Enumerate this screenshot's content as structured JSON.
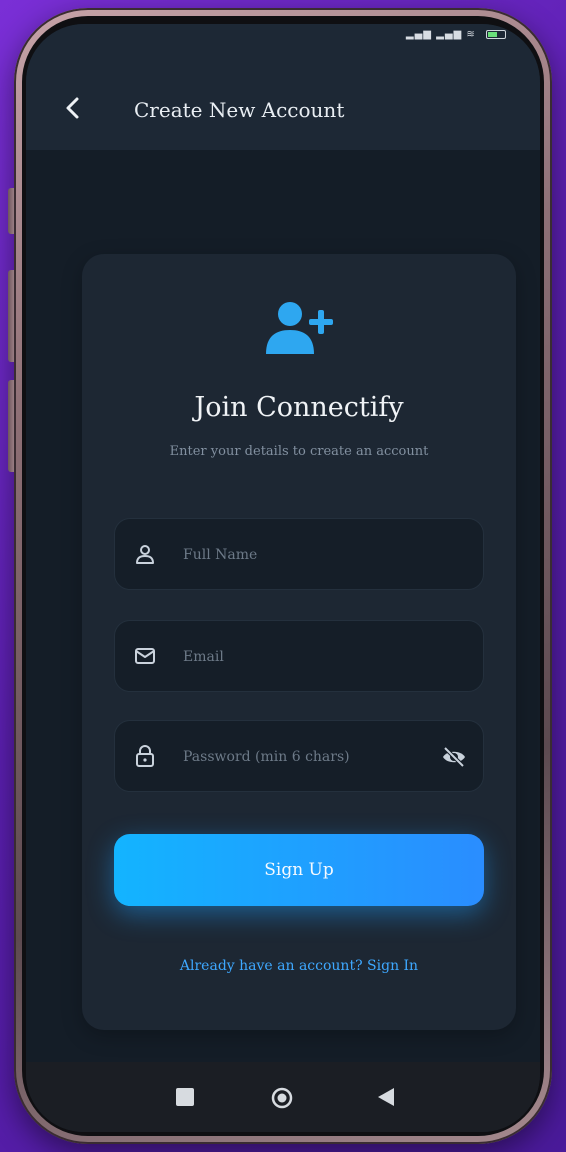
{
  "app_bar": {
    "title": "Create New Account",
    "back_icon": "chevron-left-icon"
  },
  "card": {
    "icon": "add-user-icon",
    "title": "Join Connectify",
    "subtitle": "Enter your details to create an account"
  },
  "form": {
    "full_name": {
      "placeholder": "Full Name",
      "value": "",
      "icon": "user-icon"
    },
    "email": {
      "placeholder": "Email",
      "value": "",
      "icon": "mail-icon"
    },
    "password": {
      "placeholder": "Password (min 6 chars)",
      "value": "",
      "icon": "lock-icon",
      "toggle_icon": "eye-off-icon"
    }
  },
  "signup_button": {
    "label": "Sign Up"
  },
  "signin_link": {
    "label": "Already have an account? Sign In"
  },
  "nav_bar": {
    "items": [
      "recent-apps-icon",
      "home-icon",
      "back-triangle-icon"
    ]
  },
  "colors": {
    "accent": "#1aa8ff",
    "background": "#141d27",
    "card": "#1d2733",
    "field": "#151e28",
    "text_primary": "#f0f3f6",
    "text_muted": "#8290a0"
  }
}
